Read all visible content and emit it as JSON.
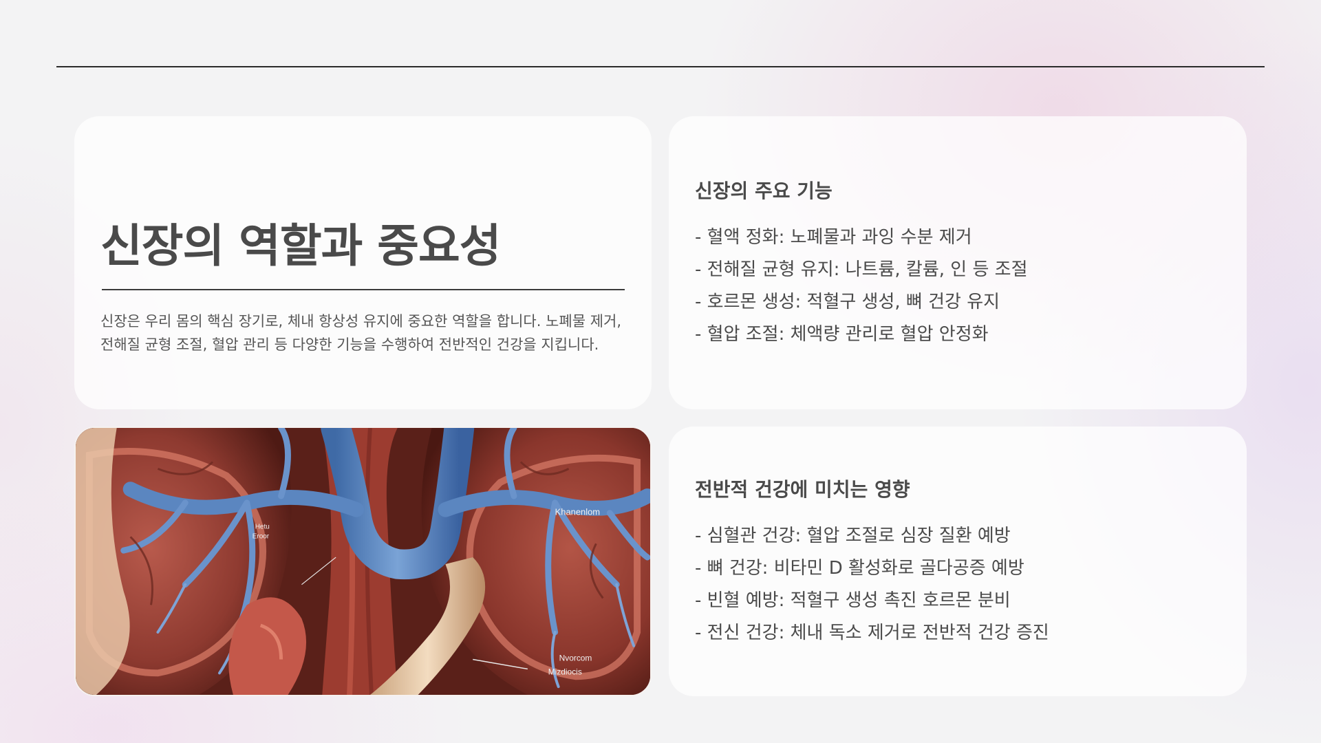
{
  "slide": {
    "title": "신장의 역할과 중요성",
    "intro": "신장은 우리 몸의 핵심 장기로, 체내 항상성 유지에 중요한 역할을 합니다. 노폐물 제거, 전해질 균형 조절, 혈압 관리 등 다양한 기능을 수행하여 전반적인 건강을 지킵니다."
  },
  "functions": {
    "heading": "신장의 주요 기능",
    "items": [
      "- 혈액 정화: 노폐물과 과잉 수분 제거",
      "- 전해질 균형 유지: 나트륨, 칼륨, 인 등 조절",
      "- 호르몬 생성: 적혈구 생성, 뼈 건강 유지",
      "- 혈압 조절: 체액량 관리로 혈압 안정화"
    ]
  },
  "impact": {
    "heading": "전반적 건강에 미치는 영향",
    "items": [
      "- 심혈관 건강: 혈압 조절로 심장 질환 예방",
      "- 뼈 건강: 비타민 D 활성화로 골다공증 예방",
      "- 빈혈 예방: 적혈구 생성 촉진 호르몬 분비",
      "- 전신 건강: 체내 독소 제거로 전반적 건강 증진"
    ]
  },
  "image": {
    "icon": "kidney-anatomy-illustration",
    "labels": [
      "Khanenlom",
      "Hetu",
      "Eroor",
      "Nvorcom",
      "Mizdiocis"
    ]
  },
  "colors": {
    "accent_rule": "#2a2a2a",
    "vessel_blue": "#5b86c0",
    "tissue_red": "#a84a3c"
  }
}
